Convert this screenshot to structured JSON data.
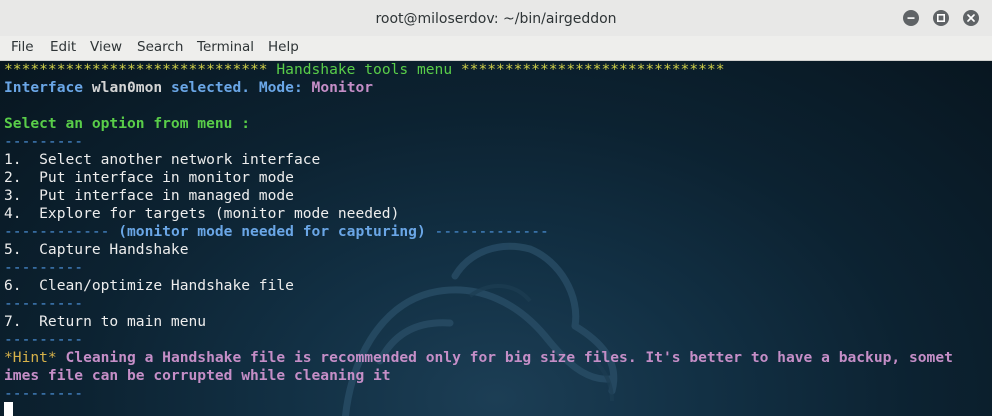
{
  "window": {
    "title": "root@miloserdov: ~/bin/airgeddon",
    "controls": [
      "minimize-icon",
      "maximize-icon",
      "close-icon"
    ]
  },
  "menubar": {
    "items": [
      "File",
      "Edit",
      "View",
      "Search",
      "Terminal",
      "Help"
    ]
  },
  "terminal": {
    "header": {
      "left_stars": "******************************",
      "title": " Handshake tools menu ",
      "right_stars": "******************************"
    },
    "interface_line": {
      "prefix": "Interface ",
      "iface": "wlan0mon",
      "middle": " selected. Mode: ",
      "mode": "Monitor"
    },
    "prompt": "Select an option from menu :",
    "separator": "---------",
    "options": [
      "1.  Select another network interface",
      "2.  Put interface in monitor mode",
      "3.  Put interface in managed mode",
      "4.  Explore for targets (monitor mode needed)"
    ],
    "section": {
      "left_dashes": "------------ ",
      "text": "(monitor mode needed for capturing)",
      "right_dashes": " -------------"
    },
    "option5": "5.  Capture Handshake",
    "option6": "6.  Clean/optimize Handshake file",
    "option7": "7.  Return to main menu",
    "hint": {
      "tag": "*Hint*",
      "line1": " Cleaning a Handshake file is recommended only for big size files. It's better to have a backup, somet",
      "line2": "imes file can be corrupted while cleaning it"
    }
  },
  "colors": {
    "titlebar": "#e8e8e7",
    "menubar": "#eeeeec",
    "terminal_bg": "#0c2231",
    "text_white": "#ededed",
    "text_green": "#59cd49",
    "text_yellow": "#cfcf48",
    "text_blue": "#4f96e0",
    "text_magenta": "#c58ec7",
    "hint_tag": "#d7b24a"
  }
}
